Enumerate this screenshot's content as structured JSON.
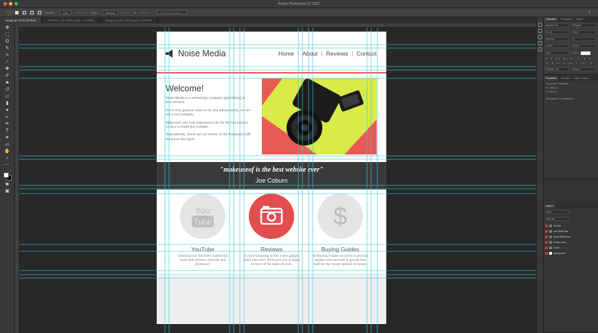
{
  "window": {
    "title": "Adobe Photoshop CC 2017",
    "traffic_lights": [
      "#ff5f57",
      "#ffbd2e",
      "#28c940"
    ]
  },
  "options_bar": {
    "feather_label": "Feather:",
    "feather_value": "0 px",
    "antialias_label": "Anti-alias",
    "style_label": "Style:",
    "style_value": "Normal",
    "width_label": "Width:",
    "height_label": "Height:",
    "select_mask_label": "Select and Mask..."
  },
  "document_tabs": [
    {
      "label": "design @ 100% (RGB/8)",
      "active": true
    },
    {
      "label": "GH-Hero-1 @ 100% (Layer 1, RGB/8)",
      "active": false
    },
    {
      "label": "design.png @ 100% (Layer 0, RGB/8)",
      "active": false
    }
  ],
  "website": {
    "brand": "Noise Media",
    "nav": [
      "Home",
      "About",
      "Reviews",
      "Contact"
    ],
    "accent_color": "#e05a5a",
    "welcome": {
      "heading": "Welcome!",
      "paragraphs": [
        "Noise Media is a technology company specializing in tech reviews.",
        "We're very good at what we do, but unfortunately, we are not a real company.",
        "Make sure you visit makeuseof.com for the full tutorial on how to build this website.",
        "Alternatively, check out our review of the Panasonic G80 shown on the right!"
      ]
    },
    "quote": "\"makeuseof is the best website ever\"",
    "quote_author": "Joe Coburn",
    "features": [
      {
        "title": "YouTube",
        "icon": "youtube-icon",
        "icon_text_top": "You",
        "icon_text_bottom": "Tube",
        "text": "Checkout our YouTube channel for more tech reviews, tutorials and giveaway!"
      },
      {
        "title": "Reviews",
        "icon": "camera-icon",
        "text": "If you're planning to buy a new gadget, check here first. We'll give you in depth reviews of the latest devices."
      },
      {
        "title": "Buying Guides",
        "icon": "dollar-icon",
        "icon_text": "$",
        "text": "At Buying Guides we strive to provide readers with the tools to get the best stuff for the lowest amount of money."
      }
    ]
  },
  "panels": {
    "character_tabs": [
      "Character",
      "Paragraph",
      "Glyphs"
    ],
    "font_family": "Myriad Pro",
    "font_style": "Regular",
    "font_size": "24 pt",
    "leading": "36 pt",
    "kerning": "Metrics",
    "tracking": "0",
    "vertical_scale": "100%",
    "horizontal_scale": "100%",
    "baseline": "0 pt",
    "color_label": "Color:",
    "language": "English: UK",
    "antialias": "Sharp",
    "properties_tabs": [
      "Properties",
      "Libraries",
      "Layer Comps"
    ],
    "properties_title": "Document Properties",
    "width_label": "W: 1366 px",
    "height_label": "H: 2000 px",
    "resolution": "Resolution: 72 pixels/inch",
    "layers_title": "Layers",
    "layers_kind": "Kind",
    "layers_mode": "Normal",
    "layers": [
      {
        "name": "Top Bar",
        "folder": true
      },
      {
        "name": "Left Middle Bar",
        "folder": true
      },
      {
        "name": "Quote Middle Bar",
        "folder": true
      },
      {
        "name": "Bottom Icons",
        "folder": true
      },
      {
        "name": "Footer",
        "folder": true
      },
      {
        "name": "Background",
        "folder": false
      }
    ]
  }
}
